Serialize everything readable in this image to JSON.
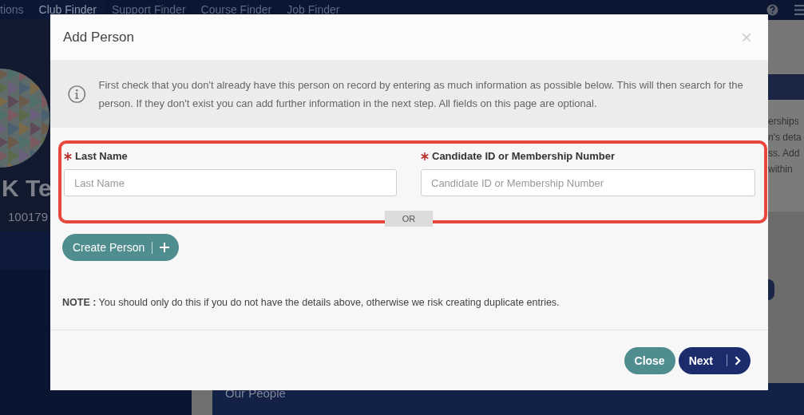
{
  "nav": {
    "items": [
      {
        "label": "tions",
        "selected": false
      },
      {
        "label": "Club Finder",
        "selected": true
      },
      {
        "label": "Support Finder",
        "selected": false
      },
      {
        "label": "Course Finder",
        "selected": false
      },
      {
        "label": "Job Finder",
        "selected": false
      }
    ]
  },
  "profile": {
    "name": "K Te",
    "number": "100179"
  },
  "background_fragments": [
    "erships",
    "n's deta",
    "ss. Add",
    "within"
  ],
  "section_title": "Our People",
  "dialog": {
    "title": "Add Person",
    "info": "First check that you don't already have this person on record by entering as much information as possible below. This will then search for the person. If they don't exist you can add further information in the next step. All fields on this page are optional.",
    "fields": [
      {
        "label": "Last Name",
        "placeholder": "Last Name",
        "required": true
      },
      {
        "label": "Candidate ID or Membership Number",
        "placeholder": "Candidate ID or Membership Number",
        "required": true
      }
    ],
    "separator": "OR",
    "create_button": "Create Person",
    "note": "**NOTE :** You should only do this if you do not have the details above, otherwise we risk creating duplicate entries.",
    "buttons": [
      {
        "label": "Close",
        "kind": "secondary"
      },
      {
        "label": "Next",
        "kind": "primary"
      }
    ]
  }
}
